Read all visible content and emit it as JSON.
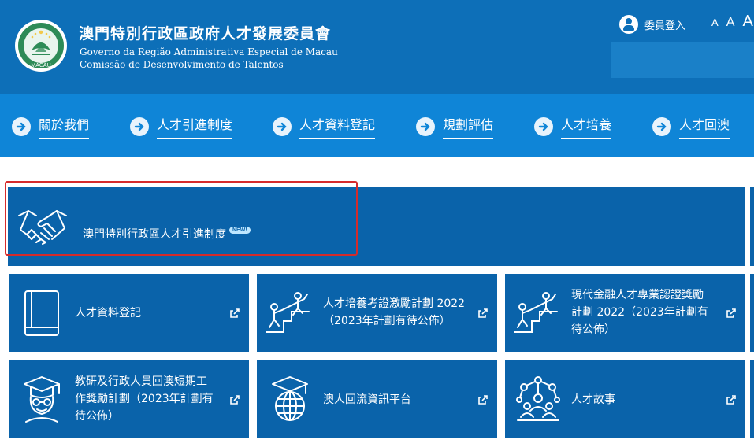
{
  "header": {
    "title_cn": "澳門特別行政區政府人才發展委員會",
    "title_pt_line1": "Governo da Região Administrativa Especial de Macau",
    "title_pt_line2": "Comissão de Desenvolvimento de Talentos",
    "emblem_label": "MACAU",
    "login_label": "委員登入",
    "font_sizes": [
      "A",
      "A",
      "A"
    ]
  },
  "nav": {
    "items": [
      {
        "label": "關於我們"
      },
      {
        "label": "人才引進制度"
      },
      {
        "label": "人才資料登記"
      },
      {
        "label": "規劃評估"
      },
      {
        "label": "人才培養"
      },
      {
        "label": "人才回澳"
      }
    ]
  },
  "feature": {
    "label": "澳門特別行政區人才引進制度",
    "badge": "NEW!"
  },
  "tiles": [
    {
      "line1": "人才資料登記",
      "line2": "",
      "line3": "",
      "icon": "book-icon"
    },
    {
      "line1": "人才培養考證激勵計劃 2022",
      "line2": "（2023年計劃有待公佈）",
      "line3": "",
      "icon": "climbing-help-icon"
    },
    {
      "line1": "現代金融人才專業認證獎勵",
      "line2": "計劃 2022（2023年計劃有",
      "line3": "待公佈）",
      "icon": "climbing-help-icon"
    },
    {
      "line1": "教研及行政人員回澳短期工",
      "line2": "作獎勵計劃（2023年計劃有",
      "line3": "待公佈）",
      "icon": "graduate-icon"
    },
    {
      "line1": "澳人回流資訊平台",
      "line2": "",
      "line3": "",
      "icon": "globe-cap-icon"
    },
    {
      "line1": "人才故事",
      "line2": "",
      "line3": "",
      "icon": "network-people-icon"
    }
  ],
  "colors": {
    "header_bg": "#0d6fb8",
    "nav_bg": "#0f85d7",
    "tile_bg": "#0a63aa",
    "highlight": "#d62b2b"
  }
}
